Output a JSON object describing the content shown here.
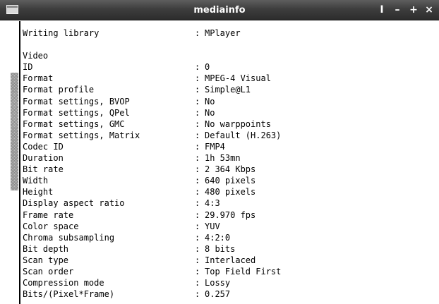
{
  "window": {
    "title": "mediainfo",
    "buttons": {
      "shade": "I",
      "minimize": "–",
      "maximize": "+",
      "close": "×"
    }
  },
  "lines": [
    {
      "key": "Writing library",
      "sep": ":",
      "value": "MPlayer"
    },
    {
      "key": "",
      "sep": "",
      "value": ""
    },
    {
      "key": "Video",
      "sep": "",
      "value": ""
    },
    {
      "key": "ID",
      "sep": ":",
      "value": "0"
    },
    {
      "key": "Format",
      "sep": ":",
      "value": "MPEG-4 Visual"
    },
    {
      "key": "Format profile",
      "sep": ":",
      "value": "Simple@L1"
    },
    {
      "key": "Format settings, BVOP",
      "sep": ":",
      "value": "No"
    },
    {
      "key": "Format settings, QPel",
      "sep": ":",
      "value": "No"
    },
    {
      "key": "Format settings, GMC",
      "sep": ":",
      "value": "No warppoints"
    },
    {
      "key": "Format settings, Matrix",
      "sep": ":",
      "value": "Default (H.263)"
    },
    {
      "key": "Codec ID",
      "sep": ":",
      "value": "FMP4"
    },
    {
      "key": "Duration",
      "sep": ":",
      "value": "1h 53mn"
    },
    {
      "key": "Bit rate",
      "sep": ":",
      "value": "2 364 Kbps"
    },
    {
      "key": "Width",
      "sep": ":",
      "value": "640 pixels"
    },
    {
      "key": "Height",
      "sep": ":",
      "value": "480 pixels"
    },
    {
      "key": "Display aspect ratio",
      "sep": ":",
      "value": "4:3"
    },
    {
      "key": "Frame rate",
      "sep": ":",
      "value": "29.970 fps"
    },
    {
      "key": "Color space",
      "sep": ":",
      "value": "YUV"
    },
    {
      "key": "Chroma subsampling",
      "sep": ":",
      "value": "4:2:0"
    },
    {
      "key": "Bit depth",
      "sep": ":",
      "value": "8 bits"
    },
    {
      "key": "Scan type",
      "sep": ":",
      "value": "Interlaced"
    },
    {
      "key": "Scan order",
      "sep": ":",
      "value": "Top Field First"
    },
    {
      "key": "Compression mode",
      "sep": ":",
      "value": "Lossy"
    },
    {
      "key": "Bits/(Pixel*Frame)",
      "sep": ":",
      "value": "0.257"
    }
  ]
}
